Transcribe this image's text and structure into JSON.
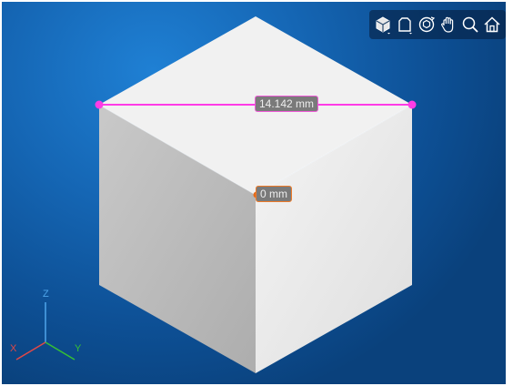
{
  "toolbar": {
    "items": [
      {
        "name": "view-cube-icon"
      },
      {
        "name": "restore-view-icon"
      },
      {
        "name": "rotate-icon"
      },
      {
        "name": "pan-hand-icon"
      },
      {
        "name": "zoom-icon"
      },
      {
        "name": "home-icon"
      }
    ]
  },
  "measurements": {
    "distance_label": "14.142 mm",
    "point_label": "0 mm"
  },
  "axes": {
    "x": "X",
    "y": "Y",
    "z": "Z"
  },
  "colors": {
    "distance_line": "#ff3ce6",
    "point_marker": "#e26a1b",
    "axis_x": "#e04848",
    "axis_y": "#35c035",
    "axis_z": "#4fa5ea"
  }
}
